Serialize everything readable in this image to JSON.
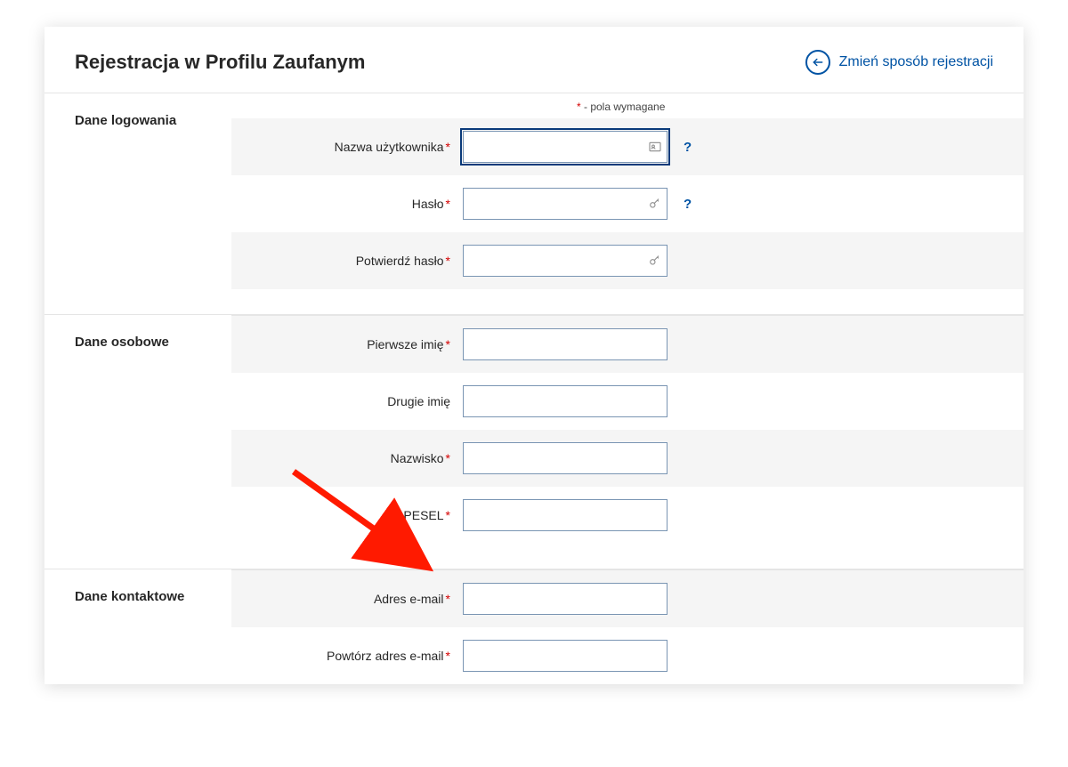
{
  "header": {
    "title": "Rejestracja w Profilu Zaufanym",
    "change_method": "Zmień sposób rejestracji"
  },
  "required_text": " - pola wymagane",
  "required_star": "*",
  "sections": {
    "login": {
      "title": "Dane logowania",
      "username_label": "Nazwa użytkownika",
      "password_label": "Hasło",
      "confirm_password_label": "Potwierdź hasło"
    },
    "personal": {
      "title": "Dane osobowe",
      "first_name_label": "Pierwsze imię",
      "second_name_label": "Drugie imię",
      "surname_label": "Nazwisko",
      "pesel_label": "PESEL"
    },
    "contact": {
      "title": "Dane kontaktowe",
      "email_label": "Adres e-mail",
      "email_repeat_label": "Powtórz adres e-mail"
    }
  },
  "help": "?"
}
